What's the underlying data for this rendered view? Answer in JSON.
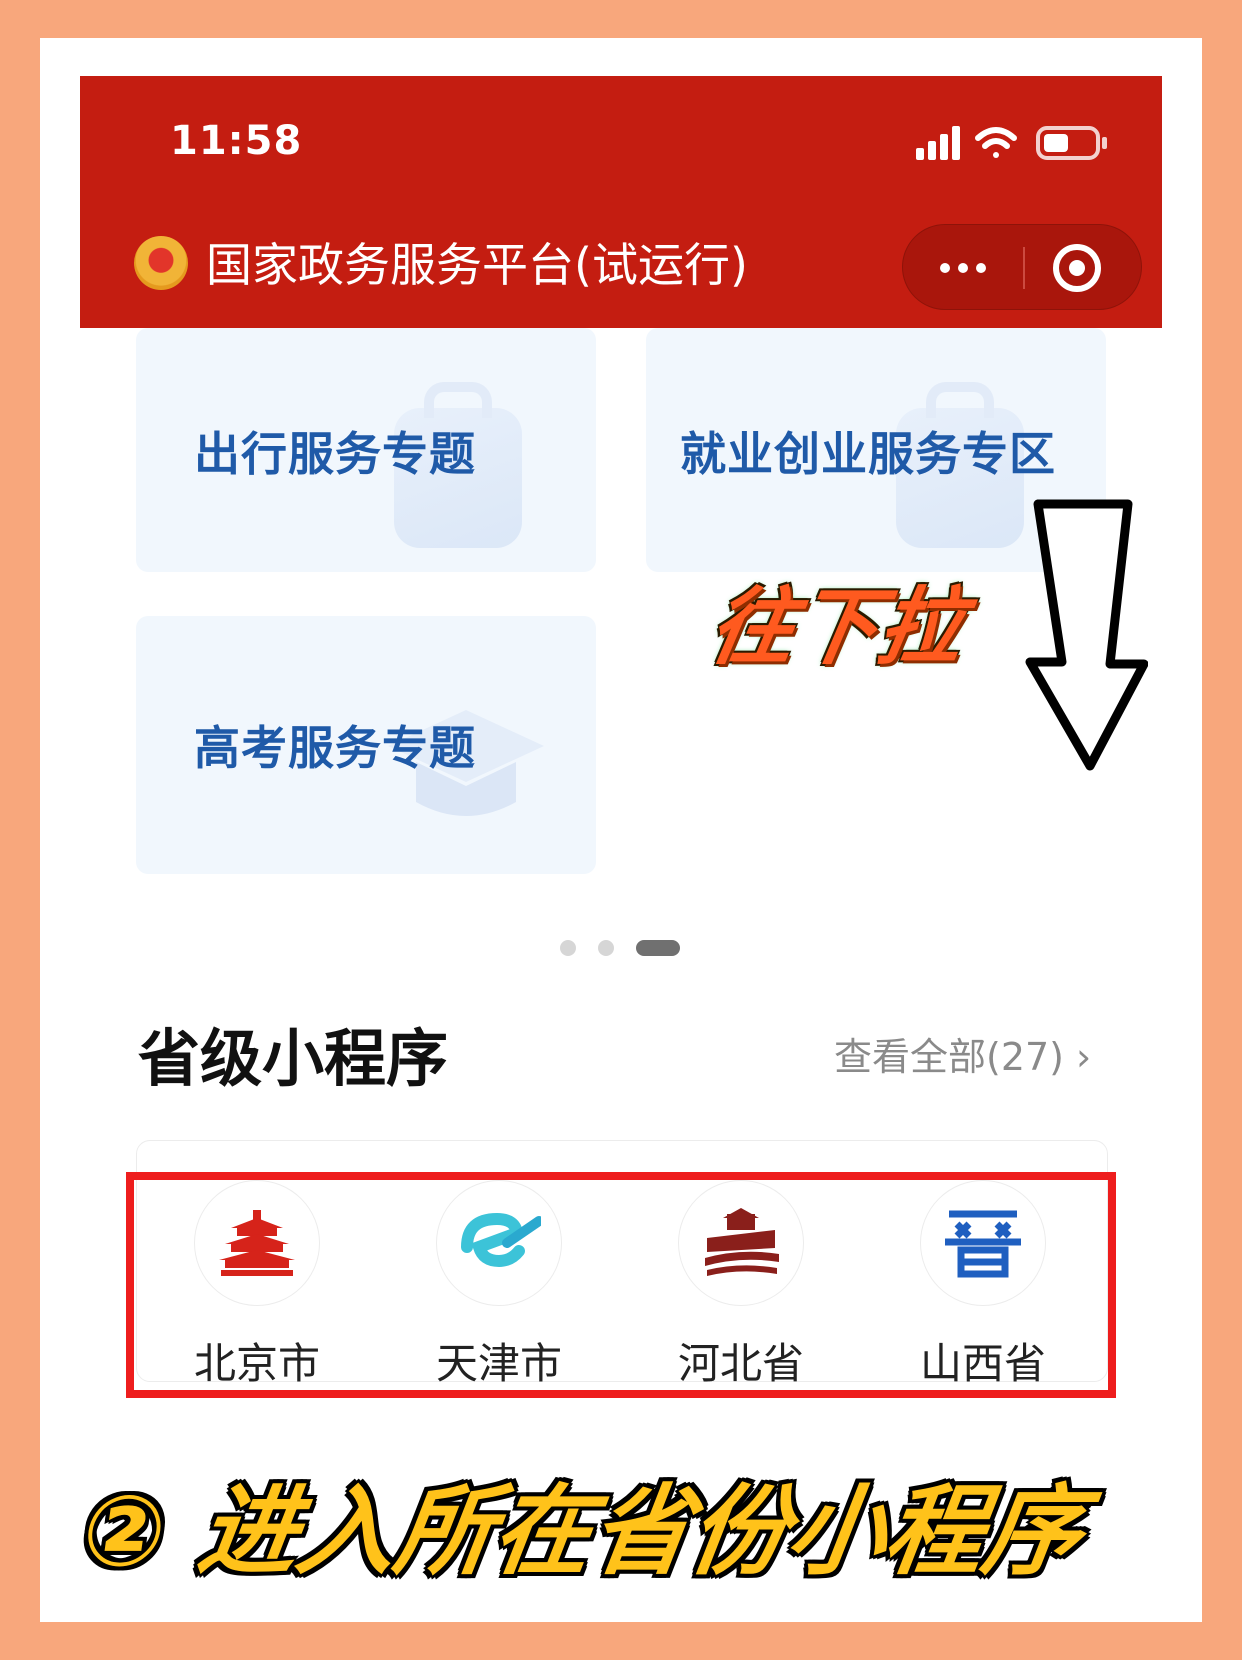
{
  "status_bar": {
    "time": "11:58"
  },
  "header": {
    "title": "国家政务服务平台(试运行)"
  },
  "tiles": [
    {
      "label": "出行服务专题"
    },
    {
      "label": "就业创业服务专区"
    },
    {
      "label": "高考服务专题"
    }
  ],
  "hint": {
    "text": "往下拉"
  },
  "pager": {
    "count": 3,
    "active_index": 2
  },
  "section": {
    "title": "省级小程序",
    "view_all": "查看全部(27)"
  },
  "provinces": [
    {
      "name": "北京市",
      "icon": "beijing-temple-logo"
    },
    {
      "name": "天津市",
      "icon": "tianjin-e-logo"
    },
    {
      "name": "河北省",
      "icon": "hebei-great-wall-logo"
    },
    {
      "name": "山西省",
      "icon": "shanxi-jin-logo"
    }
  ],
  "footer": {
    "text": "② 进入所在省份小程序"
  },
  "colors": {
    "page_bg": "#f8a77c",
    "header_red": "#c41d11",
    "tile_text": "#1f5aa8",
    "highlight": "#ee1d1d",
    "footer_text": "#ffc21a"
  }
}
